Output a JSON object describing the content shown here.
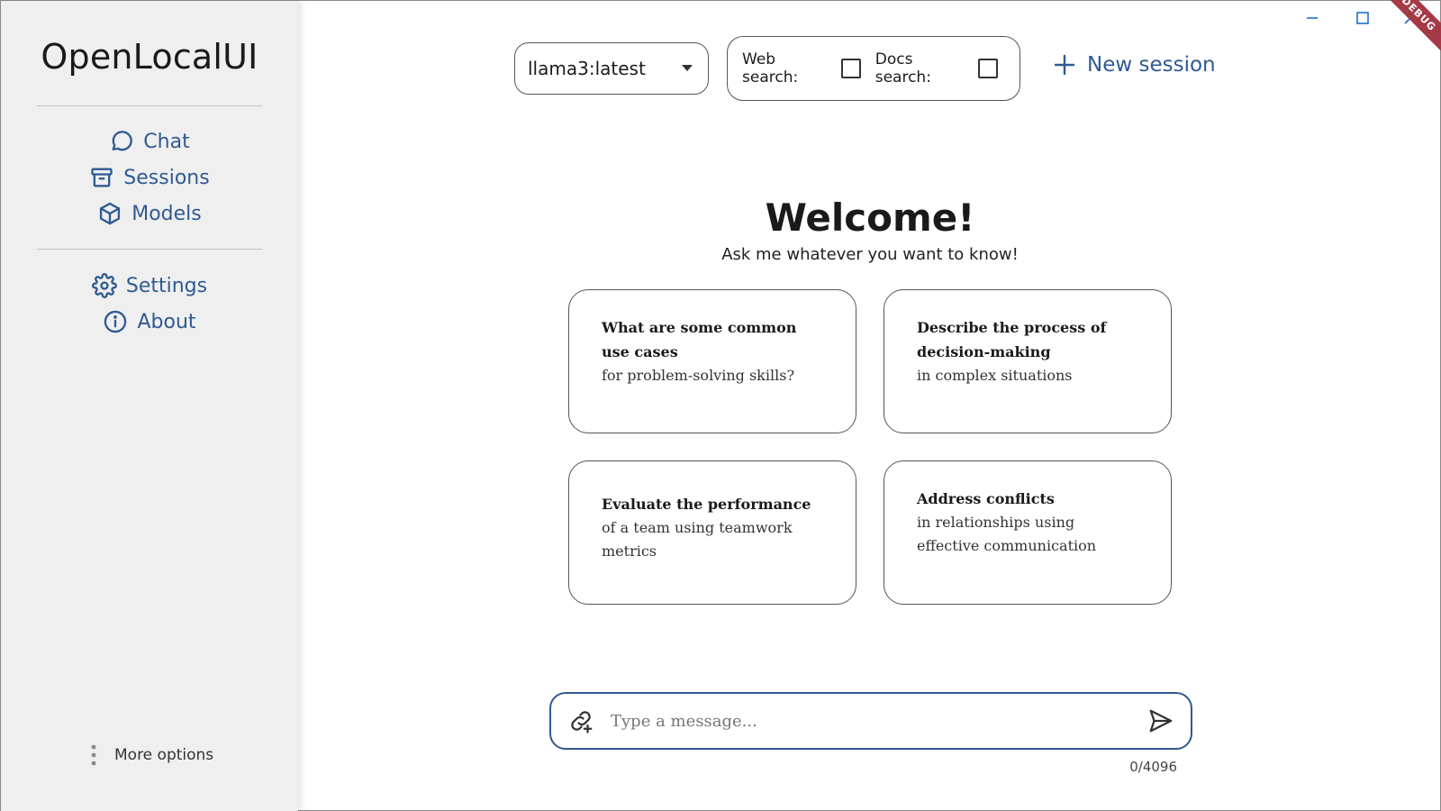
{
  "app": {
    "title": "OpenLocalUI"
  },
  "sidebar": {
    "nav_primary": [
      {
        "label": "Chat",
        "icon": "chat-bubble-icon"
      },
      {
        "label": "Sessions",
        "icon": "archive-box-icon"
      },
      {
        "label": "Models",
        "icon": "cube-icon"
      }
    ],
    "nav_secondary": [
      {
        "label": "Settings",
        "icon": "gear-icon"
      },
      {
        "label": "About",
        "icon": "info-circle-icon"
      }
    ],
    "more_options_label": "More options"
  },
  "toolbar": {
    "model_selected": "llama3:latest",
    "web_search_label": "Web search:",
    "web_search_checked": false,
    "docs_search_label": "Docs search:",
    "docs_search_checked": false,
    "new_session_label": "New session"
  },
  "window": {
    "debug_label": "DEBUG"
  },
  "welcome": {
    "title": "Welcome!",
    "subtitle": "Ask me whatever you want to know!"
  },
  "suggestions": [
    {
      "title": "What are some common use cases",
      "subtitle": "for problem-solving skills?"
    },
    {
      "title": "Describe the process of decision-making",
      "subtitle": "in complex situations"
    },
    {
      "title": "Evaluate the performance",
      "subtitle": "of a team using teamwork metrics"
    },
    {
      "title": "Address conflicts",
      "subtitle": "in relationships using effective communication"
    }
  ],
  "composer": {
    "placeholder": "Type a message...",
    "value": "",
    "char_count": "0/4096"
  },
  "colors": {
    "accent": "#2f5a92",
    "sidebar_bg": "#efefef",
    "debug_ribbon": "#a53a47"
  }
}
